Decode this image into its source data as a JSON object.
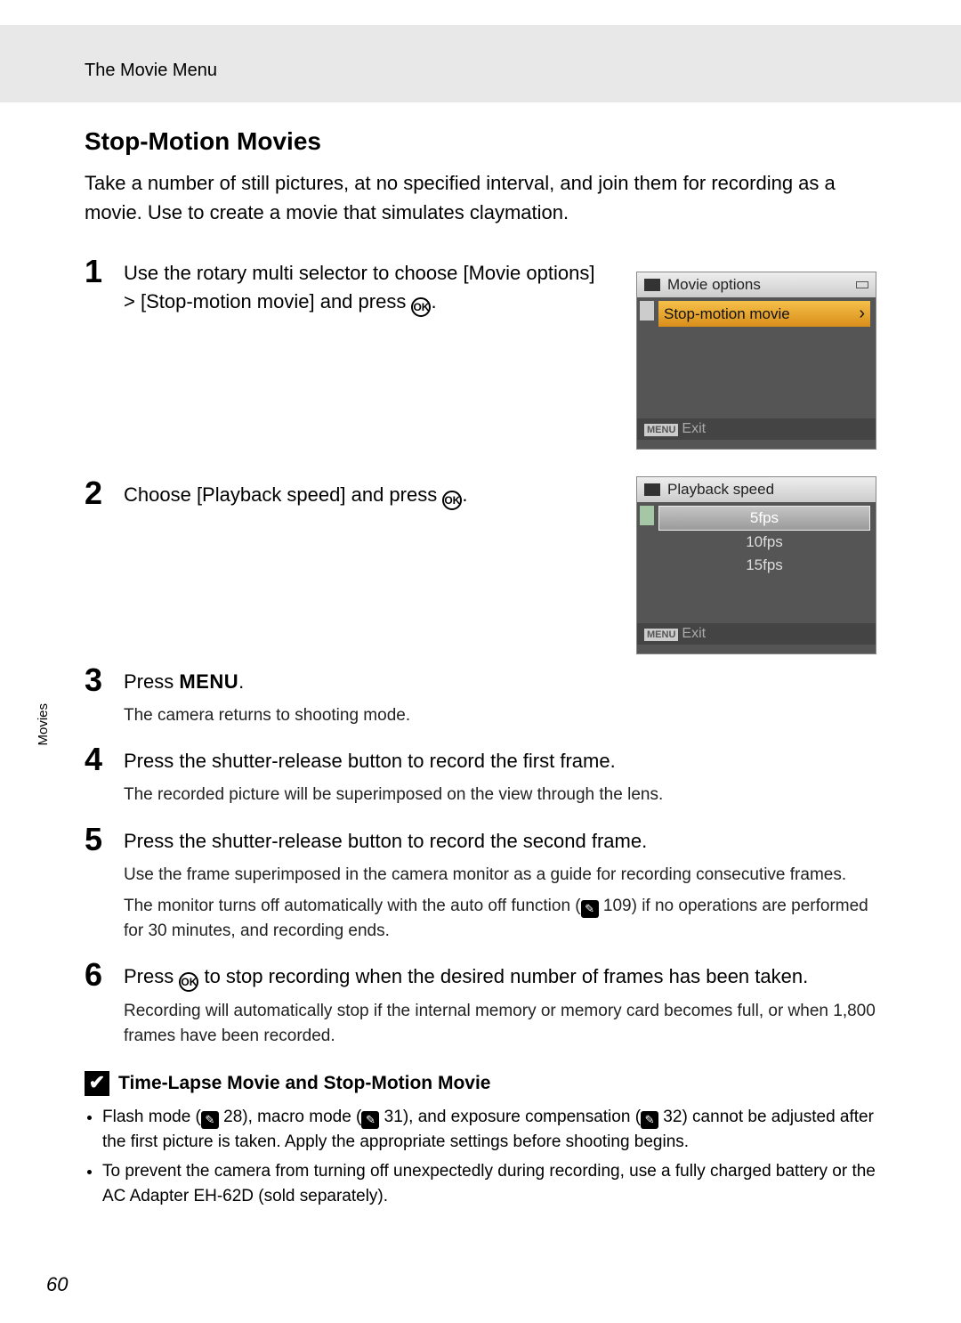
{
  "header": {
    "breadcrumb": "The Movie Menu"
  },
  "section": {
    "title": "Stop-Motion Movies",
    "intro": "Take a number of still pictures, at no specified interval, and join them for recording as a movie. Use to create a movie that simulates claymation."
  },
  "steps": [
    {
      "num": "1",
      "text_pre": "Use the rotary multi selector to choose [Movie options] > [Stop-motion movie] and press ",
      "text_post": "."
    },
    {
      "num": "2",
      "text_pre": "Choose [Playback speed] and press ",
      "text_post": "."
    },
    {
      "num": "3",
      "text_pre": "Press ",
      "text_menu": "MENU",
      "text_post": ".",
      "sub1": "The camera returns to shooting mode."
    },
    {
      "num": "4",
      "text": "Press the shutter-release button to record the first frame.",
      "sub1": "The recorded picture will be superimposed on the view through the lens."
    },
    {
      "num": "5",
      "text": "Press the shutter-release button to record the second frame.",
      "sub1": "Use the frame superimposed in the camera monitor as a guide for recording consecutive frames.",
      "sub2_pre": "The monitor turns off automatically with the auto off function (",
      "sub2_ref": " 109",
      "sub2_post": ") if no operations are performed for 30 minutes, and recording ends."
    },
    {
      "num": "6",
      "text_pre": "Press ",
      "text_post": " to stop recording when the desired number of frames has been taken.",
      "sub1": "Recording will automatically stop if the internal memory or memory card becomes full, or when 1,800 frames have been recorded."
    }
  ],
  "lcd1": {
    "title": "Movie options",
    "item": "Stop-motion movie",
    "footer_menu": "MENU",
    "footer_text": "Exit"
  },
  "lcd2": {
    "title": "Playback speed",
    "items": [
      "5fps",
      "10fps",
      "15fps"
    ],
    "footer_menu": "MENU",
    "footer_text": "Exit"
  },
  "note": {
    "title": "Time-Lapse Movie and Stop-Motion Movie",
    "items": [
      {
        "pre": "Flash mode (",
        "ref1": " 28",
        "mid1": "), macro mode (",
        "ref2": " 31",
        "mid2": "), and exposure compensation (",
        "ref3": " 32",
        "post": ") cannot be adjusted after the first picture is taken. Apply the appropriate settings before shooting begins."
      },
      {
        "text": "To prevent the camera from turning off unexpectedly during recording, use a fully charged battery or the AC Adapter EH-62D (sold separately)."
      }
    ]
  },
  "side_tab": "Movies",
  "page_number": "60",
  "ok_glyph": "OK"
}
